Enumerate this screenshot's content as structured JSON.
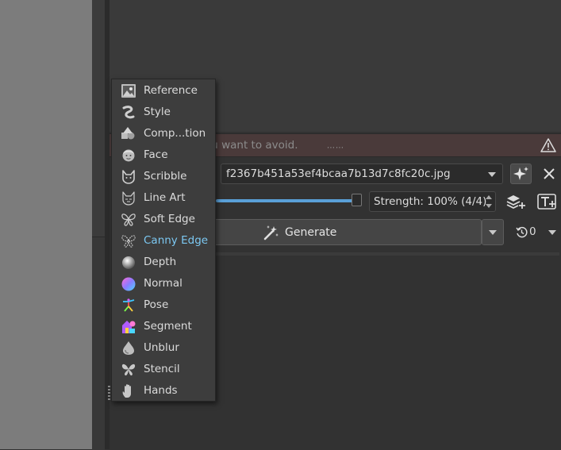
{
  "negative_prompt": {
    "placeholder_fragment": "ou want to avoid.",
    "warning_icon": "warning-triangle-icon"
  },
  "control_layer": {
    "image_name": "f2367b451a53ef4bcaa7b13d7c8fc20c.jpg",
    "strength_label": "Strength: 100% (4/4)",
    "strength_value": 1.0
  },
  "generate": {
    "label": "Generate",
    "history_count": "0"
  },
  "menu": {
    "active_item": "Canny Edge",
    "active_color": "#7cc8f2",
    "items": [
      {
        "label": "Reference",
        "icon": "image-icon"
      },
      {
        "label": "Style",
        "icon": "style-swirl-icon"
      },
      {
        "label": "Comp...tion",
        "icon": "composition-shapes-icon"
      },
      {
        "label": "Face",
        "icon": "face-icon"
      },
      {
        "label": "Scribble",
        "icon": "cat-scribble-icon"
      },
      {
        "label": "Line Art",
        "icon": "cat-lineart-icon"
      },
      {
        "label": "Soft Edge",
        "icon": "butterfly-soft-icon"
      },
      {
        "label": "Canny Edge",
        "icon": "butterfly-canny-icon"
      },
      {
        "label": "Depth",
        "icon": "depth-sphere-icon"
      },
      {
        "label": "Normal",
        "icon": "normal-sphere-icon"
      },
      {
        "label": "Pose",
        "icon": "pose-figure-icon"
      },
      {
        "label": "Segment",
        "icon": "segment-icon"
      },
      {
        "label": "Unblur",
        "icon": "unblur-drop-icon"
      },
      {
        "label": "Stencil",
        "icon": "butterfly-stencil-icon"
      },
      {
        "label": "Hands",
        "icon": "hand-icon"
      }
    ]
  }
}
